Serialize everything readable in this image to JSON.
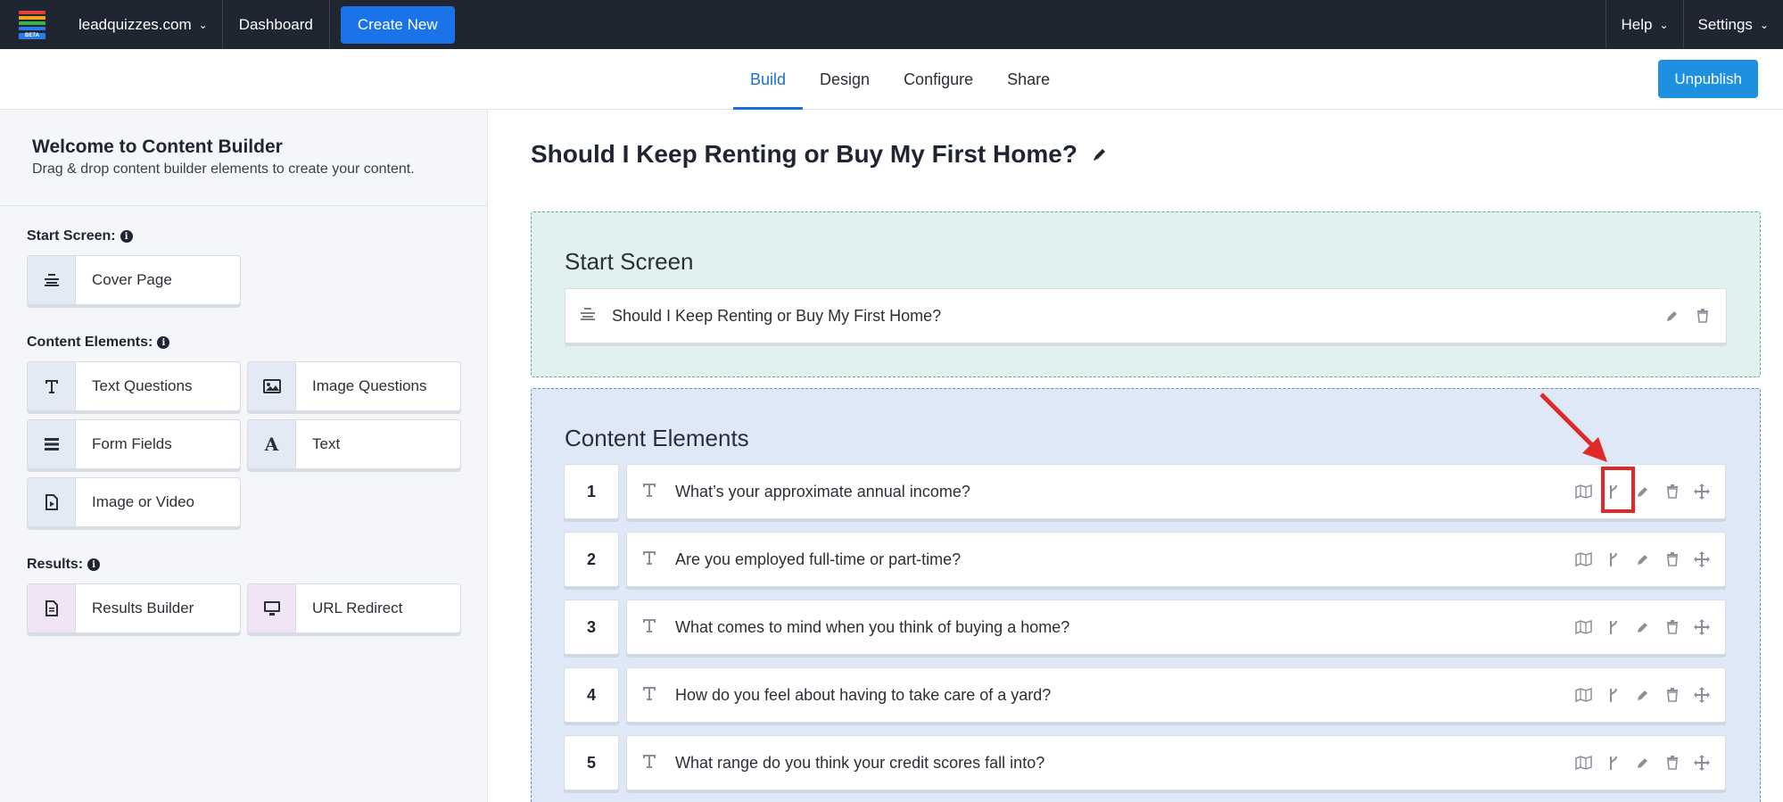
{
  "topbar": {
    "site": "leadquizzes.com",
    "dashboard": "Dashboard",
    "create_new": "Create New",
    "help": "Help",
    "settings": "Settings",
    "logo_badge": "BETA"
  },
  "tabs": {
    "build": "Build",
    "design": "Design",
    "configure": "Configure",
    "share": "Share",
    "unpublish": "Unpublish"
  },
  "sidebar": {
    "title": "Welcome to Content Builder",
    "subtitle": "Drag & drop content builder elements to create your content.",
    "start_label": "Start Screen:",
    "content_label": "Content Elements:",
    "results_label": "Results:",
    "tiles": {
      "cover_page": "Cover Page",
      "text_questions": "Text Questions",
      "image_questions": "Image Questions",
      "form_fields": "Form Fields",
      "text": "Text",
      "image_or_video": "Image or Video",
      "results_builder": "Results Builder",
      "url_redirect": "URL Redirect"
    }
  },
  "main": {
    "quiz_title": "Should I Keep Renting or Buy My First Home?",
    "start_screen_title": "Start Screen",
    "start_item": "Should I Keep Renting or Buy My First Home?",
    "content_title": "Content Elements",
    "questions": [
      {
        "num": "1",
        "text": "What’s your approximate annual income?"
      },
      {
        "num": "2",
        "text": "Are you employed full-time or part-time?"
      },
      {
        "num": "3",
        "text": "What comes to mind when you think of buying a home?"
      },
      {
        "num": "4",
        "text": "How do you feel about having to take care of a yard?"
      },
      {
        "num": "5",
        "text": "What range do you think your credit scores fall into?"
      }
    ]
  },
  "colors": {
    "topbar_bg": "#1f2531",
    "accent_blue": "#1a73e8",
    "annotation_red": "#e02828"
  },
  "icons": [
    "map-icon",
    "branch-icon",
    "pencil-icon",
    "trash-icon",
    "move-icon",
    "text-icon",
    "cover-icon"
  ]
}
